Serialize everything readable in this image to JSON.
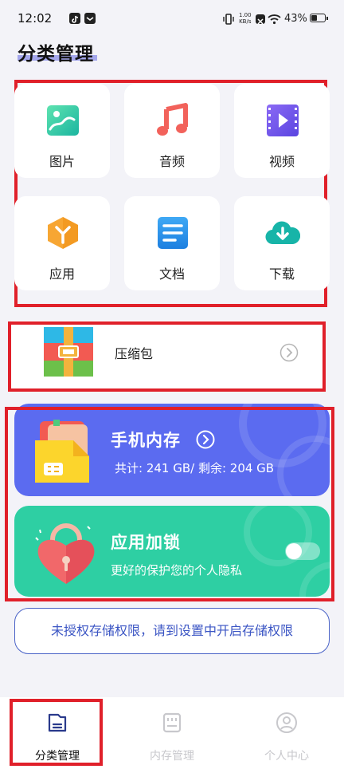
{
  "status_bar": {
    "time": "12:02",
    "net_speed": "1.00",
    "net_unit": "KB/s",
    "battery": "43%"
  },
  "page": {
    "title": "分类管理"
  },
  "categories": [
    {
      "label": "图片",
      "icon": "image-icon"
    },
    {
      "label": "音频",
      "icon": "music-note-icon"
    },
    {
      "label": "视频",
      "icon": "video-icon"
    },
    {
      "label": "应用",
      "icon": "app-box-icon"
    },
    {
      "label": "文档",
      "icon": "document-icon"
    },
    {
      "label": "下载",
      "icon": "cloud-download-icon"
    }
  ],
  "archive": {
    "label": "压缩包",
    "icon": "archive-icon"
  },
  "storage_card": {
    "title": "手机内存",
    "detail": "共计: 241 GB/ 剩余: 204 GB",
    "color": "#5b6bf0"
  },
  "lock_card": {
    "title": "应用加锁",
    "subtitle": "更好的保护您的个人隐私",
    "color": "#2ecfa3",
    "toggle_on": false
  },
  "permission_notice": "未授权存储权限，请到设置中开启存储权限",
  "tabs": [
    {
      "label": "分类管理",
      "icon": "folder-doc-icon",
      "active": true
    },
    {
      "label": "内存管理",
      "icon": "sd-card-icon",
      "active": false
    },
    {
      "label": "个人中心",
      "icon": "user-icon",
      "active": false
    }
  ],
  "colors": {
    "accent": "#3c56c4",
    "highlight_box": "#e0202a",
    "inactive_tab": "#c8c8cc"
  }
}
